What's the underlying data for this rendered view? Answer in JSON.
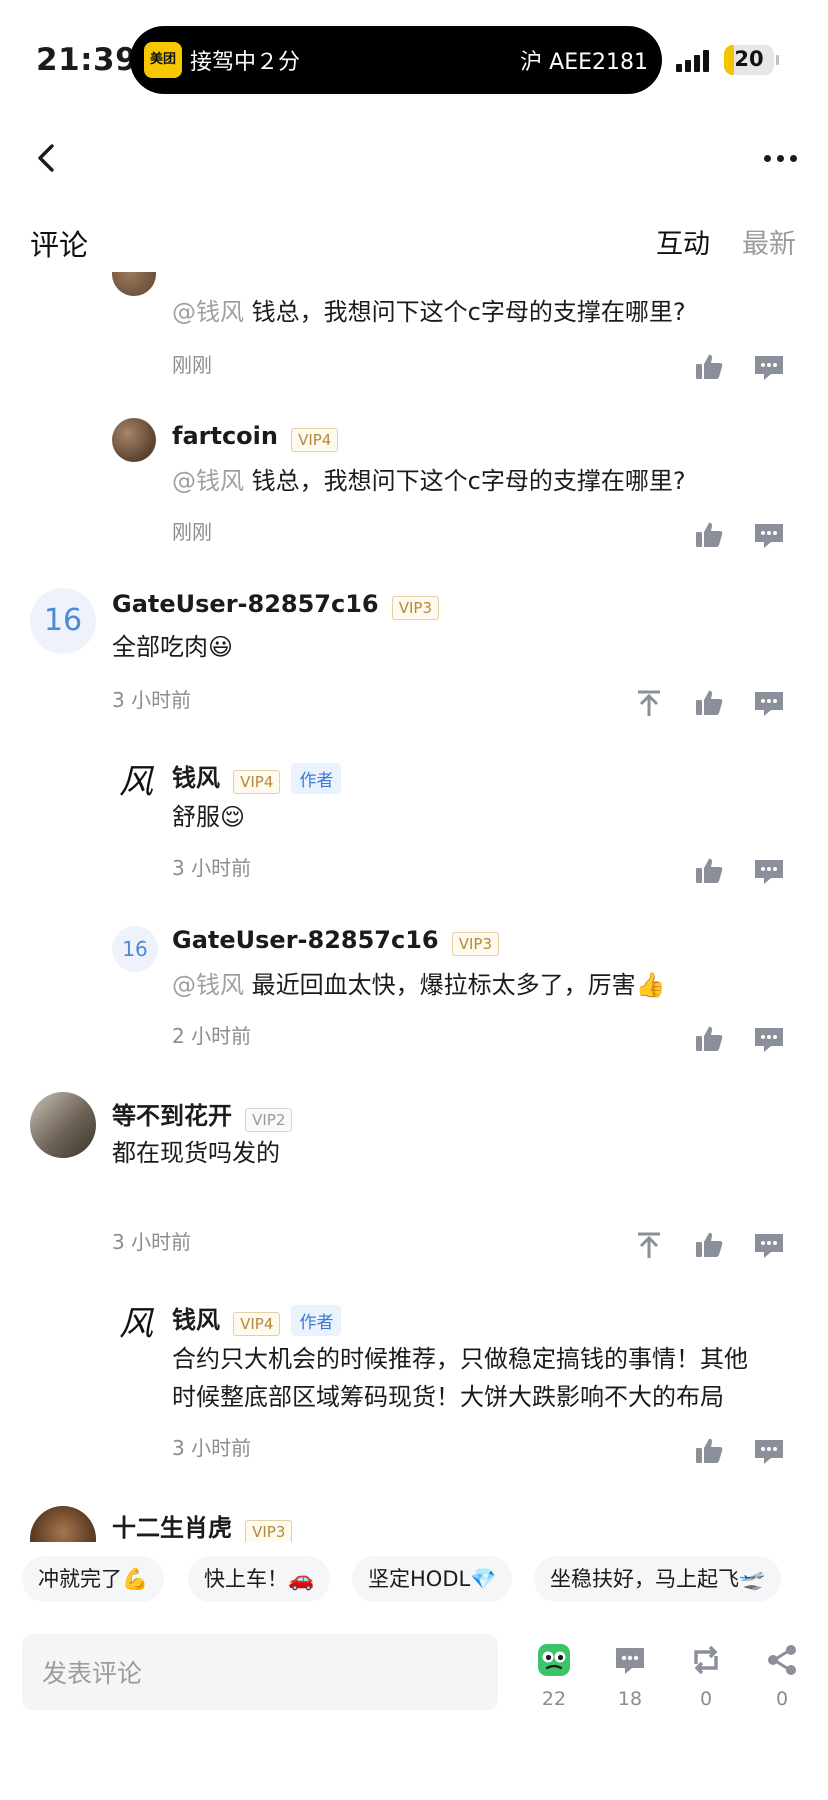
{
  "status_bar": {
    "time": "21:39",
    "island": {
      "app_badge": "美团",
      "ride_status": "接驾中２分",
      "plate": "沪 AEE2181"
    },
    "battery": 20,
    "battery_text": "20"
  },
  "nav": {
    "back_icon": "chevron-left-icon",
    "more_icon": "more-dots-icon"
  },
  "comments_header": {
    "title": "评论",
    "tabs": [
      {
        "label": "互动",
        "active": true
      },
      {
        "label": "最新",
        "active": false
      }
    ]
  },
  "comments": [
    {
      "id": "c0",
      "reply": true,
      "mention": "@钱风",
      "text": " 钱总，我想问下这个c字母的支撑在哪里?",
      "time": "刚刚"
    },
    {
      "id": "c1",
      "reply": true,
      "user": "fartcoin",
      "vip": "VIP4",
      "mention": "@钱风",
      "text": " 钱总，我想问下这个c字母的支撑在哪里?",
      "time": "刚刚"
    },
    {
      "id": "c2",
      "reply": false,
      "avatar_text": "16",
      "user": "GateUser-82857c16",
      "vip": "VIP3",
      "text": "全部吃肉😃",
      "time": "3 小时前"
    },
    {
      "id": "c3",
      "reply": true,
      "avatar_text": "风",
      "user": "钱风",
      "vip": "VIP4",
      "author_tag": "作者",
      "text": "舒服😌",
      "time": "3 小时前"
    },
    {
      "id": "c4",
      "reply": true,
      "avatar_text": "16",
      "user": "GateUser-82857c16",
      "vip": "VIP3",
      "mention": "@钱风",
      "text": " 最近回血太快，爆拉标太多了，厉害👍",
      "time": "2 小时前"
    },
    {
      "id": "c5",
      "reply": false,
      "user": "等不到花开",
      "vip": "VIP2",
      "text": "都在现货吗发的",
      "time": "3 小时前"
    },
    {
      "id": "c6",
      "reply": true,
      "avatar_text": "风",
      "user": "钱风",
      "vip": "VIP4",
      "author_tag": "作者",
      "text_lines": [
        "合约只大机会的时候推荐，只做稳定搞钱的事情！其他",
        "时候整底部区域筹码现货！大饼大跌影响不大的布局"
      ],
      "time": "3 小时前"
    },
    {
      "id": "c7",
      "reply": false,
      "user": "十二生肖虎",
      "vip": "VIP3"
    }
  ],
  "quick_replies": [
    "冲就完了💪",
    "快上车！🚗",
    "坚定HODL💎",
    "坐稳扶好，马上起飞🛫"
  ],
  "bottom_bar": {
    "input_placeholder": "发表评论",
    "actions": [
      {
        "icon": "emoji-reaction-icon",
        "count": "22"
      },
      {
        "icon": "comment-icon",
        "count": "18"
      },
      {
        "icon": "repost-icon",
        "count": "0"
      },
      {
        "icon": "share-icon",
        "count": "0"
      }
    ]
  },
  "colors": {
    "accent_blue": "#3a7bd5",
    "vip_gold": "#b48a3a",
    "muted_text": "#8d8d8d",
    "icon_gray": "#8a8f99",
    "reaction_green": "#3cc46b"
  }
}
